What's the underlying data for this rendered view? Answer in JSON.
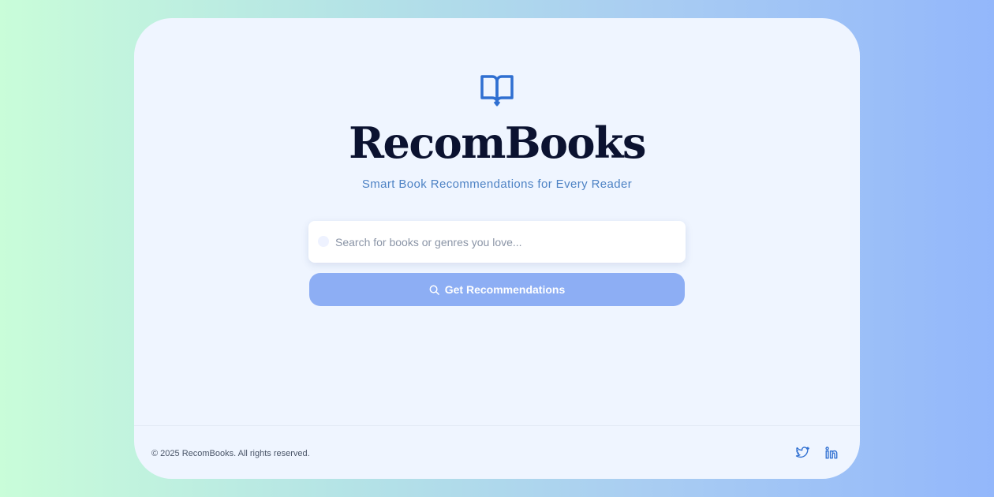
{
  "brand": {
    "title": "RecomBooks",
    "subtitle": "Smart Book Recommendations for Every Reader",
    "logo_icon": "open-book-icon"
  },
  "search": {
    "placeholder": "Search for books or genres you love...",
    "value": ""
  },
  "cta": {
    "label": "Get Recommendations",
    "icon": "search-icon"
  },
  "footer": {
    "copyright": "© 2025 RecomBooks. All rights reserved.",
    "social": [
      {
        "name": "twitter-icon"
      },
      {
        "name": "linkedin-icon"
      }
    ]
  },
  "colors": {
    "accent": "#2f6fd1",
    "title": "#0b1230",
    "subtitle": "#4d82c4",
    "button": "#8daef4",
    "card": "#eff5ff"
  }
}
